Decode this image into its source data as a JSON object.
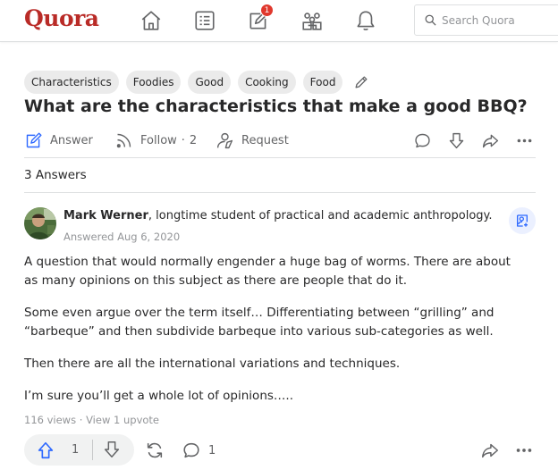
{
  "brand": "Quora",
  "nav": {
    "notifications_badge": "1",
    "search_placeholder": "Search Quora"
  },
  "topics": [
    "Characteristics",
    "Foodies",
    "Good",
    "Cooking",
    "Food"
  ],
  "question": "What are the characteristics that make a good BBQ?",
  "actions": {
    "answer": "Answer",
    "follow": "Follow",
    "follow_count": "2",
    "request": "Request"
  },
  "answers_count": "3 Answers",
  "answer": {
    "author": "Mark Werner",
    "credential": ", longtime student of practical and academic anthropology.",
    "date": "Answered Aug 6, 2020",
    "paragraphs": [
      "A question that would normally engender a huge bag of worms. There are about as many opinions on this subject as there are people that do it.",
      "Some even argue over the term itself… Differentiating between “grilling” and “barbeque” and then subdivide barbeque into various sub-categories as well.",
      "Then there are all the international variations and techniques.",
      "I’m sure you’ll get a whole lot of opinions….."
    ],
    "views": "116 views",
    "upvote_link": "View 1 upvote",
    "upvotes": "1",
    "comments": "1"
  },
  "colors": {
    "brand": "#b92b27",
    "accent": "#2e69ff",
    "muted": "#636466"
  }
}
